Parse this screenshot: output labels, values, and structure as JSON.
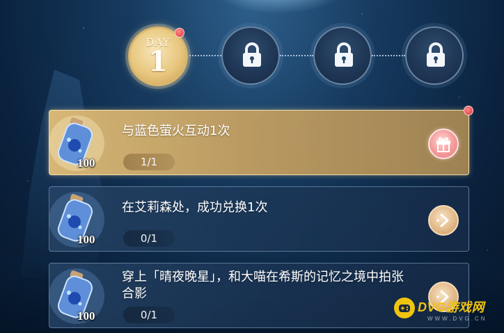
{
  "days": [
    {
      "label": "DAY",
      "number": "1",
      "state": "active",
      "has_notice": true
    },
    {
      "label": "",
      "number": "",
      "state": "locked",
      "has_notice": false
    },
    {
      "label": "",
      "number": "",
      "state": "locked",
      "has_notice": false
    },
    {
      "label": "",
      "number": "",
      "state": "locked",
      "has_notice": false
    }
  ],
  "tasks": [
    {
      "title": "与蓝色萤火互动1次",
      "reward_amount": "100",
      "progress": "1/1",
      "state": "complete",
      "action_icon": "gift-icon",
      "has_notice": true
    },
    {
      "title": "在艾莉森处，成功兑换1次",
      "reward_amount": "100",
      "progress": "0/1",
      "state": "pending",
      "action_icon": "go-arrow-icon",
      "has_notice": false
    },
    {
      "title": "穿上「晴夜晚星」，和大喵在希斯的记忆之境中拍张合影",
      "reward_amount": "100",
      "progress": "0/1",
      "state": "pending",
      "action_icon": "go-arrow-icon",
      "has_notice": false
    }
  ],
  "watermark": {
    "name": "DVG游戏网",
    "url": "WWW.DVG.CN"
  },
  "colors": {
    "gold": "#e8c77f",
    "notice_red": "#e0303a",
    "gift_pink": "#f49a9a"
  }
}
